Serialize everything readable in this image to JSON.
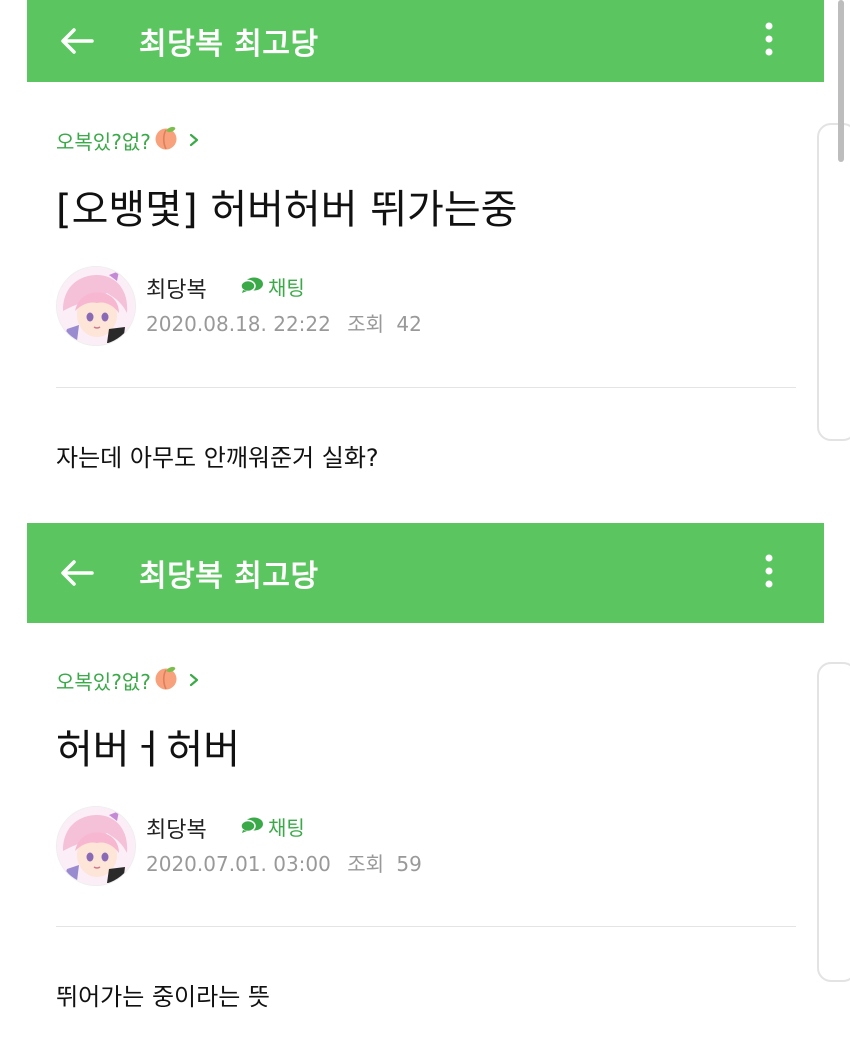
{
  "colors": {
    "appbar": "#5bc65f",
    "accent_text": "#3aaa48",
    "meta_text": "#999999"
  },
  "posts": [
    {
      "appbar": {
        "back_icon": "arrow-left-icon",
        "title": "최당복 최고당",
        "more_icon": "vertical-dots-icon"
      },
      "category": {
        "label": "오복있?없?",
        "emoji_icon": "peach-icon",
        "chevron_icon": "chevron-right-icon"
      },
      "title": "[오뱅몇] 허버허버 뛰가는중",
      "author": {
        "name": "최당복",
        "avatar": "avatar-image",
        "chat_label": "채팅",
        "chat_icon": "chat-bubble-icon"
      },
      "meta": {
        "datetime": "2020.08.18. 22:22",
        "views_label": "조회",
        "views": "42"
      },
      "body": "자는데 아무도 안깨워준거 실화?"
    },
    {
      "appbar": {
        "back_icon": "arrow-left-icon",
        "title": "최당복 최고당",
        "more_icon": "vertical-dots-icon"
      },
      "category": {
        "label": "오복있?없?",
        "emoji_icon": "peach-icon",
        "chevron_icon": "chevron-right-icon"
      },
      "title": "허버ㅓ허버",
      "author": {
        "name": "최당복",
        "avatar": "avatar-image",
        "chat_label": "채팅",
        "chat_icon": "chat-bubble-icon"
      },
      "meta": {
        "datetime": "2020.07.01. 03:00",
        "views_label": "조회",
        "views": "59"
      },
      "body": "뛰어가는 중이라는 뜻"
    }
  ]
}
